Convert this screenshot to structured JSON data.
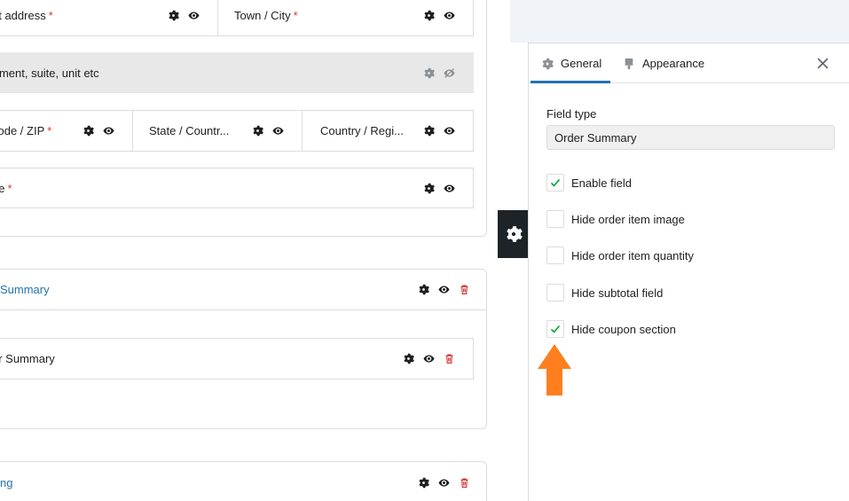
{
  "builder": {
    "fields_row1": {
      "street": {
        "label": "et address",
        "required": "*"
      },
      "town": {
        "label": "Town / City",
        "required": "*"
      }
    },
    "apartment": {
      "placeholder": "rtment, suite, unit etc"
    },
    "fields_row3": {
      "zip": {
        "label": "code / ZIP",
        "required": "*"
      },
      "state": {
        "label": "State / Countr..."
      },
      "country": {
        "label": "Country / Regi..."
      }
    },
    "phone": {
      "label": "ne",
      "required": "*"
    },
    "order_group": {
      "title": "Summary"
    },
    "order_field": {
      "label": "er Summary"
    },
    "bottom_group": {
      "title": "ng"
    }
  },
  "panel": {
    "tabs": [
      {
        "label": "General",
        "icon": "gear-icon",
        "active": true
      },
      {
        "label": "Appearance",
        "icon": "brush-icon",
        "active": false
      }
    ],
    "field_type_label": "Field type",
    "field_type_value": "Order Summary",
    "options": [
      {
        "label": "Enable field",
        "checked": true
      },
      {
        "label": "Hide order item image",
        "checked": false
      },
      {
        "label": "Hide order item quantity",
        "checked": false
      },
      {
        "label": "Hide subtotal field",
        "checked": false
      },
      {
        "label": "Hide coupon section",
        "checked": true
      }
    ]
  },
  "colors": {
    "accent": "#2271b1",
    "required": "#d63638",
    "check": "#00a32a",
    "arrow": "#ff7f1f",
    "toggle_bg": "#1d2327"
  }
}
